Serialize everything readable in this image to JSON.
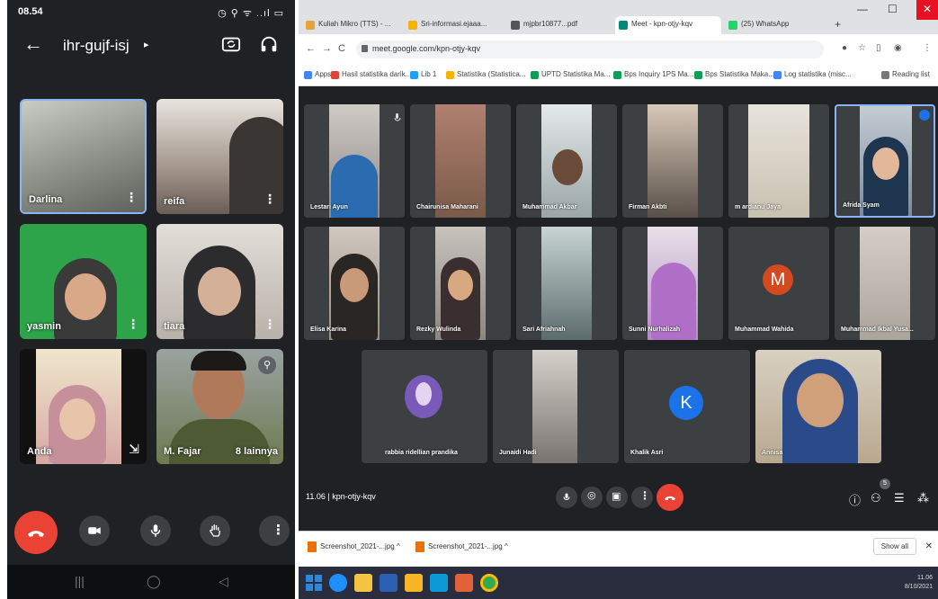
{
  "phone": {
    "status": {
      "time": "08.54",
      "icons": "◷ ⚲ ᯤ ..ıl ▭"
    },
    "header": {
      "back": "←",
      "meeting_code": "ihr-gujf-isj",
      "code_arrow": "▸"
    },
    "tiles": [
      {
        "name": "Darlina",
        "menu": "⋮",
        "bg": "#8d9088"
      },
      {
        "name": "reifa",
        "menu": "⋮",
        "bg": "#a4968c"
      },
      {
        "name": "yasmin",
        "menu": "⋮",
        "bg": "#2ea44a"
      },
      {
        "name": "tiara",
        "menu": "⋮",
        "bg": "#b8b2aa"
      },
      {
        "name": "Anda",
        "menu": "⇲",
        "bg": "#d6a9a3"
      },
      {
        "name": "M. Fajar",
        "extra": "8 lainnya",
        "bg": "#6e7a52"
      }
    ],
    "controls": [
      "end-call",
      "camera",
      "microphone",
      "raise-hand",
      "more"
    ],
    "nav": [
      "|||",
      "◯",
      "◁"
    ]
  },
  "browser": {
    "tabs": [
      {
        "label": "Kuliah Mikro (TTS) - ...",
        "color": "#e8a23a"
      },
      {
        "label": "Sri-informasi.ejaaa...",
        "color": "#f4b400"
      },
      {
        "label": "mjpbr10877...pdf",
        "color": "#555555"
      },
      {
        "label": "Meet - kpn-otjy-kqv",
        "color": "#00897b",
        "active": true
      },
      {
        "label": "(25) WhatsApp",
        "color": "#25d366"
      }
    ],
    "new_tab": "+",
    "window_buttons": {
      "min": "—",
      "max": "☐",
      "close": "✕"
    },
    "address": {
      "back": "←",
      "forward": "→",
      "reload": "C",
      "url": "meet.google.com/kpn-otjy-kqv"
    },
    "bookmarks": [
      {
        "label": "Apps",
        "color": "#4285f4"
      },
      {
        "label": "Hasil statistika darik...",
        "color": "#db4437"
      },
      {
        "label": "Lib 1",
        "color": "#1da1f2"
      },
      {
        "label": "Statistika (Statistica...",
        "color": "#f4b400"
      },
      {
        "label": "UPTD Statistika Ma...",
        "color": "#0f9d58"
      },
      {
        "label": "Bps Inquiry 1PS Ma...",
        "color": "#0f9d58"
      },
      {
        "label": "Bps Statistika Maka...",
        "color": "#0f9d58"
      },
      {
        "label": "Log statistika (misc...",
        "color": "#4285f4"
      }
    ],
    "reading_list": "Reading list",
    "participants": [
      {
        "name": "Lestari Ayun",
        "bg": "#8c8884"
      },
      {
        "name": "Chairunisa Maharani",
        "bg": "#7a5a48"
      },
      {
        "name": "Muhammad Akbar",
        "bg": "#9aa6a8"
      },
      {
        "name": "Firman Akbti",
        "bg": "#5a5048"
      },
      {
        "name": "m ardianu Jaya",
        "bg": "#c8c0b0"
      },
      {
        "name": "Afrida Syam",
        "bg": "#7c8898"
      },
      {
        "name": "Elisa Karina",
        "bg": "#9a8c80"
      },
      {
        "name": "Rezky Wulinda",
        "bg": "#8c8680"
      },
      {
        "name": "Sari Afriahnah",
        "bg": "#5c6c6c"
      },
      {
        "name": "Sunni Nurhalizah",
        "bg": "#b48cc4"
      },
      {
        "name": "Muhammad Wahida",
        "avatar": "M",
        "avatar_color": "#d44a1e"
      },
      {
        "name": "Muhammad Ikbal Yusa...",
        "bg": "#aaa49c"
      },
      {
        "name": "rabbia ridellian prandika",
        "avatar_color": "#7a5ab8"
      },
      {
        "name": "Junaidi Hadi",
        "bg": "#7a7470"
      },
      {
        "name": "Khalik Asri",
        "avatar": "K",
        "avatar_color": "#1a73e8"
      },
      {
        "name": "Annisa",
        "bg": "#5a7aa8"
      }
    ],
    "bottom": {
      "time": "11.06",
      "separator": "|",
      "meeting_code": "kpn-otjy-kqv",
      "badge": "5"
    },
    "downloads": [
      {
        "label": "Screenshot_2021-...jpg ^"
      },
      {
        "label": "Screenshot_2021-...jpg ^"
      }
    ],
    "show_all": "Show all",
    "download_close": "✕",
    "clock": {
      "time": "11.06",
      "date": "8/10/2021"
    }
  }
}
